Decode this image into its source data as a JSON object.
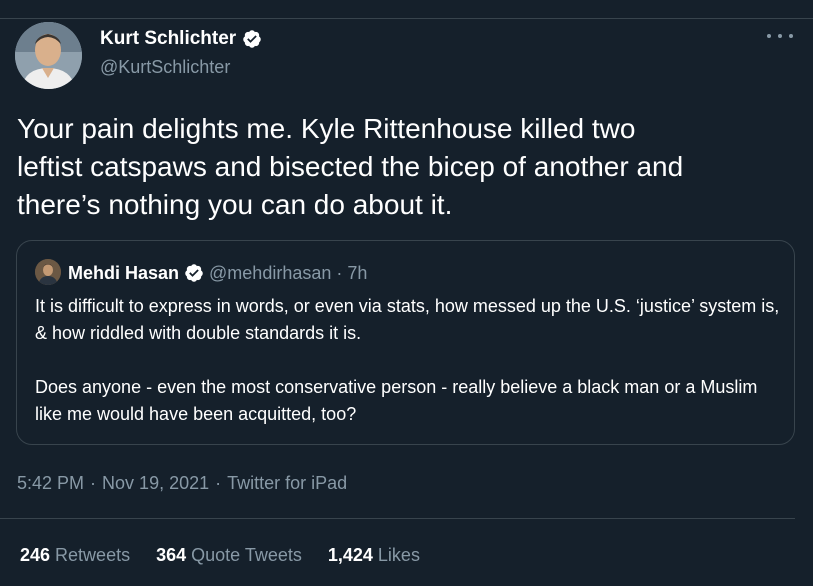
{
  "author": {
    "name": "Kurt Schlichter",
    "handle": "@KurtSchlichter",
    "verified": true
  },
  "tweet": {
    "text": "Your pain delights me. Kyle Rittenhouse killed two\nleftist catspaws and bisected the bicep of another and\nthere’s nothing you can do about it."
  },
  "quote": {
    "name": "Mehdi Hasan",
    "handle": "@mehdirhasan",
    "separator": "·",
    "time": "7h",
    "paragraphs": [
      "It is difficult to express in words, or even via stats, how messed up the U.S. ‘justice’ system is, & how riddled with double standards it is.",
      "Does anyone - even the most conservative person - really believe a black man or a Muslim like me would have been acquitted, too?"
    ]
  },
  "meta": {
    "time": "5:42 PM",
    "separator": "·",
    "date": "Nov 19, 2021",
    "source": "Twitter for iPad"
  },
  "stats": {
    "retweets_count": "246",
    "retweets_label": "Retweets",
    "quotes_count": "364",
    "quotes_label": "Quote Tweets",
    "likes_count": "1,424",
    "likes_label": "Likes"
  },
  "colors": {
    "background": "#15202b",
    "secondary_text": "#8899a6",
    "divider": "#38444d"
  },
  "icons": {
    "verified": "verified-badge-icon",
    "more": "more-icon"
  }
}
